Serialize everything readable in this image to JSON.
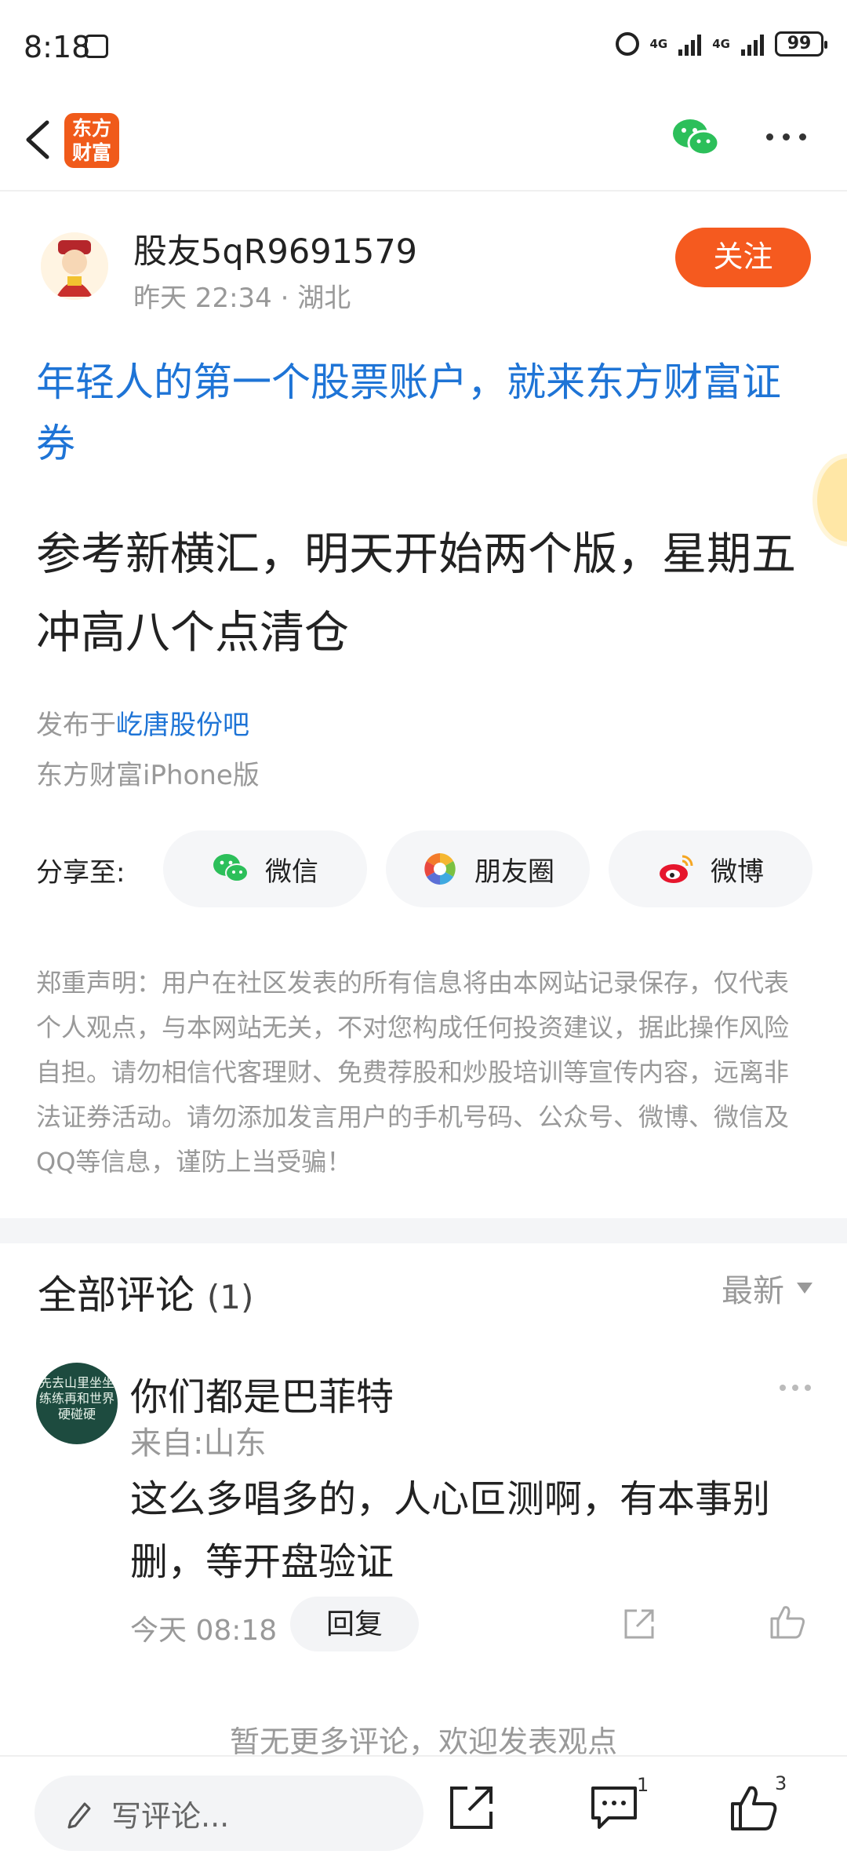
{
  "status_bar": {
    "time": "8:18",
    "network1": "4G",
    "network2": "4G",
    "battery": "99"
  },
  "nav": {
    "logo_text_line1": "东方",
    "logo_text_line2": "财富"
  },
  "post": {
    "author": "股友5qR9691579",
    "meta": "昨天 22:34 · 湖北",
    "follow_label": "关注",
    "ad_title": "年轻人的第一个股票账户，就来东方财富证券",
    "body": "参考新横汇，明天开始两个版，星期五冲高八个点清仓",
    "published_prefix": "发布于",
    "published_bar": "屹唐股份吧",
    "client": "东方财富iPhone版"
  },
  "share": {
    "label": "分享至:",
    "wechat": "微信",
    "moments": "朋友圈",
    "weibo": "微博"
  },
  "disclaimer": "郑重声明：用户在社区发表的所有信息将由本网站记录保存，仅代表个人观点，与本网站无关，不对您构成任何投资建议，据此操作风险自担。请勿相信代客理财、免费荐股和炒股培训等宣传内容，远离非法证券活动。请勿添加发言用户的手机号码、公众号、微博、微信及QQ等信息，谨防上当受骗！",
  "comments": {
    "title": "全部评论",
    "count": "(1)",
    "sort_label": "最新",
    "items": [
      {
        "avatar_text": "先去山里坐坐练练再和世界硬碰硬",
        "name": "你们都是巴菲特",
        "location": "来自:山东",
        "text": "这么多唱多的，人心叵测啊，有本事别删，等开盘验证",
        "time": "今天 08:18",
        "reply_label": "回复"
      }
    ],
    "no_more": "暂无更多评论，欢迎发表观点"
  },
  "bottom_bar": {
    "input_placeholder": "写评论...",
    "comment_badge": "1",
    "like_badge": "3"
  },
  "colors": {
    "brand_orange": "#f55a1f",
    "link_blue": "#1e74d6",
    "muted_gray": "#999999"
  }
}
